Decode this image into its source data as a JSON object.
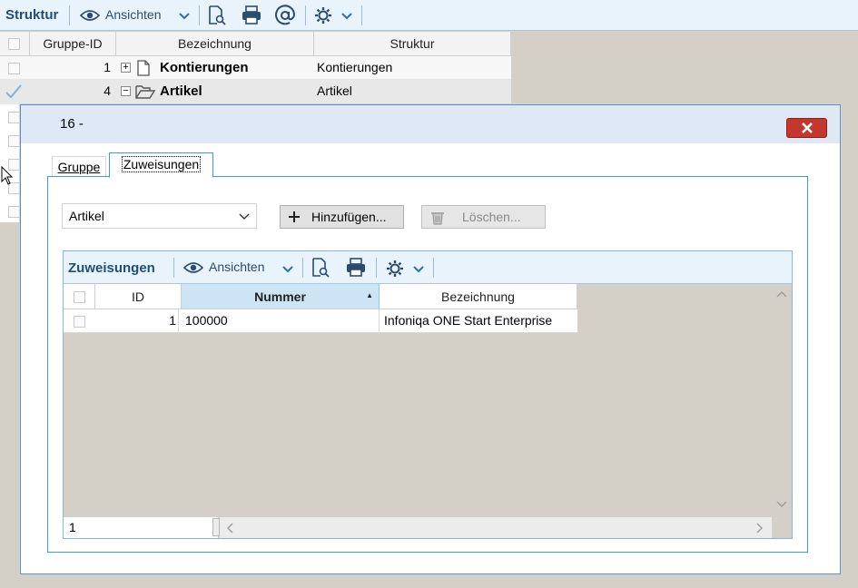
{
  "background": {
    "toolbar": {
      "title": "Struktur",
      "views_label": "Ansichten"
    },
    "columns": [
      "Gruppe-ID",
      "Bezeichnung",
      "Struktur"
    ],
    "rows": [
      {
        "id": "1",
        "name": "Kontierungen",
        "structure": "Kontierungen",
        "expander": "+"
      },
      {
        "id": "4",
        "name": "Artikel",
        "structure": "Artikel",
        "expander": "−"
      }
    ]
  },
  "dialog": {
    "title": "16 -",
    "tabs": [
      {
        "label": "Gruppe"
      },
      {
        "label": "Zuweisungen"
      }
    ],
    "select": {
      "value": "Artikel"
    },
    "add_button": "Hinzufügen...",
    "delete_button": "Löschen...",
    "grid": {
      "title": "Zuweisungen",
      "views_label": "Ansichten",
      "columns": [
        "ID",
        "Nummer",
        "Bezeichnung"
      ],
      "sort_indicator": "▲",
      "rows": [
        {
          "id": "1",
          "number": "100000",
          "name": "Infoniqa ONE Start Enterprise"
        }
      ],
      "footer_count": "1"
    }
  },
  "colors": {
    "accent": "#1f4e79",
    "close": "#c4372c",
    "selected_header": "#cce4f3"
  }
}
